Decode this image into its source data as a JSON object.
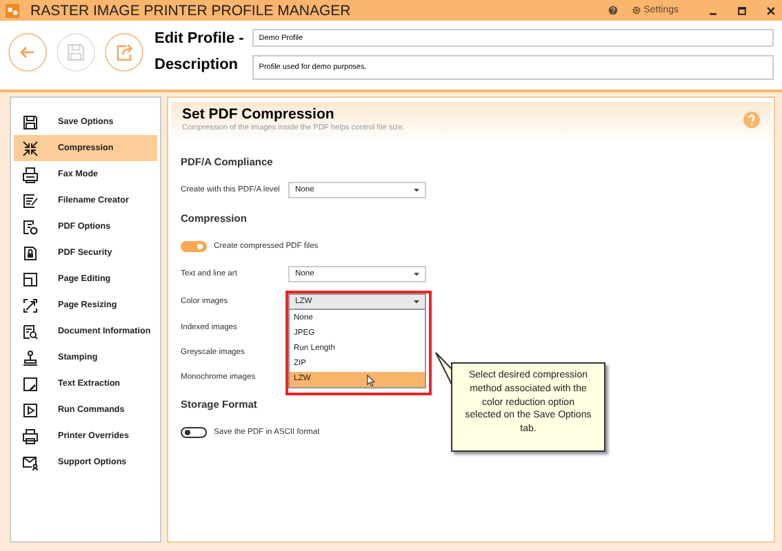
{
  "window": {
    "title": "RASTER IMAGE PRINTER PROFILE MANAGER",
    "settings_label": "Settings"
  },
  "toolbar": [
    {
      "kind": "back",
      "disabled": false
    },
    {
      "kind": "save",
      "disabled": true
    },
    {
      "kind": "export",
      "disabled": false
    }
  ],
  "profile": {
    "name_label": "Edit Profile -",
    "name_value": "Demo Profile",
    "description_label": "Description",
    "description_value": "Profile used for demo purposes."
  },
  "sidebar": {
    "items": [
      {
        "label": "Save Options",
        "selected": false
      },
      {
        "label": "Compression",
        "selected": true
      },
      {
        "label": "Fax Mode",
        "selected": false
      },
      {
        "label": "Filename Creator",
        "selected": false
      },
      {
        "label": "PDF Options",
        "selected": false
      },
      {
        "label": "PDF Security",
        "selected": false
      },
      {
        "label": "Page Editing",
        "selected": false
      },
      {
        "label": "Page Resizing",
        "selected": false
      },
      {
        "label": "Document Information",
        "selected": false
      },
      {
        "label": "Stamping",
        "selected": false
      },
      {
        "label": "Text Extraction",
        "selected": false
      },
      {
        "label": "Run Commands",
        "selected": false
      },
      {
        "label": "Printer Overrides",
        "selected": false
      },
      {
        "label": "Support Options",
        "selected": false
      }
    ]
  },
  "panel": {
    "title": "Set PDF Compression",
    "subtitle": "Compression of the images inside the PDF helps control file size.",
    "rows": [
      {
        "kind": "section",
        "label": "PDF/A Compliance"
      },
      {
        "kind": "select",
        "label": "Create with this PDF/A level",
        "value": "None"
      },
      {
        "kind": "section",
        "label": "Compression"
      },
      {
        "kind": "toggle",
        "label": "Create compressed PDF files",
        "on": true
      },
      {
        "kind": "select",
        "label": "Text and line art",
        "value": "None"
      },
      {
        "kind": "open_select",
        "label": "Color images",
        "value": "LZW",
        "options": [
          {
            "label": "None",
            "selected": false
          },
          {
            "label": "JPEG",
            "selected": false
          },
          {
            "label": "Run Length",
            "selected": false
          },
          {
            "label": "ZIP",
            "selected": false
          },
          {
            "label": "LZW",
            "selected": true
          }
        ]
      },
      {
        "kind": "label",
        "label": "Indexed images"
      },
      {
        "kind": "label",
        "label": "Greyscale images"
      },
      {
        "kind": "label",
        "label": "Monochrome images"
      },
      {
        "kind": "section",
        "label": "Storage Format"
      },
      {
        "kind": "toggle",
        "label": "Save the PDF in ASCII format",
        "on": false
      }
    ]
  },
  "callout": {
    "text": "Select desired compression method associated with the color reduction option selected on the Save Options tab."
  }
}
